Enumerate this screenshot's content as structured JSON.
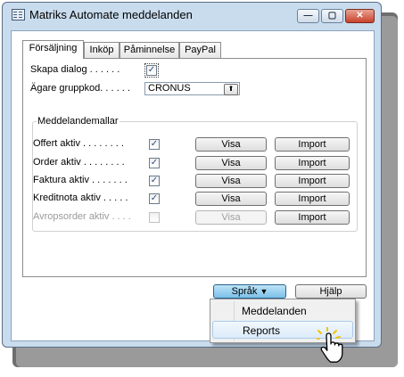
{
  "window": {
    "title": "Matriks Automate meddelanden",
    "min_glyph": "—",
    "max_glyph": "▢",
    "close_glyph": "✕"
  },
  "tabs": [
    {
      "label": "Försäljning",
      "active": true
    },
    {
      "label": "Inköp",
      "active": false
    },
    {
      "label": "Påminnelse",
      "active": false
    },
    {
      "label": "PayPal",
      "active": false
    }
  ],
  "form": {
    "skapa_dialog": {
      "label": "Skapa dialog . . . . . .",
      "checked": true,
      "check_glyph": "✓"
    },
    "agare_gruppkod": {
      "label": "Ägare gruppkod. . . . . .",
      "value": "CRONUS",
      "lookup_glyph": "⬆"
    }
  },
  "group": {
    "title": "Meddelandemallar",
    "rows": [
      {
        "label": "Offert aktiv . . . . . . . .",
        "checked": true,
        "enabled": true,
        "visa": "Visa",
        "import": "Import"
      },
      {
        "label": "Order aktiv . . . . . . . .",
        "checked": true,
        "enabled": true,
        "visa": "Visa",
        "import": "Import"
      },
      {
        "label": "Faktura aktiv . . . . . . .",
        "checked": true,
        "enabled": true,
        "visa": "Visa",
        "import": "Import"
      },
      {
        "label": "Kreditnota aktiv . . . . .",
        "checked": true,
        "enabled": true,
        "visa": "Visa",
        "import": "Import"
      },
      {
        "label": "Avropsorder aktiv . . . .",
        "checked": false,
        "enabled": false,
        "visa": "Visa",
        "import": "Import"
      }
    ]
  },
  "footer": {
    "sprak": "Språk",
    "sprak_arrow": "▼",
    "hjalp": "Hjälp"
  },
  "dropdown_menu": {
    "items": [
      {
        "label": "Meddelanden",
        "hover": false
      },
      {
        "label": "Reports",
        "hover": true
      }
    ]
  },
  "colors": {
    "window_frame": "#c9dcee",
    "close_button": "#c8412c",
    "checkbox_tick": "#2a4f86",
    "pressed_button": "#7cc0e8"
  },
  "icons": [
    "window-app-icon",
    "minimize-icon",
    "maximize-icon",
    "close-icon",
    "lookup-arrow-icon",
    "dropdown-arrow-icon",
    "hand-pointer-icon"
  ]
}
